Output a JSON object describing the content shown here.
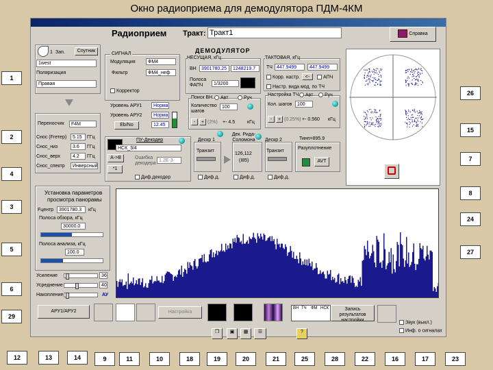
{
  "page_title": "Окно радиоприема для демодулятора ПДМ-4КМ",
  "window": {
    "header_title": "Радиоприем",
    "trakt_label": "Тракт:",
    "trakt_value": "Тракт1",
    "help_button": "Справка"
  },
  "antenna": {
    "zap_label": "Зап.",
    "zap_value": "1",
    "sputnik_button": "Спутник",
    "satellite_value": "1west",
    "polarization_label": "Поляризация",
    "polarization_value": "Правая"
  },
  "converter": {
    "perenoschik_label": "Переносчик",
    "perenoschik_value": "F4M",
    "rows": [
      {
        "label": "Снос (Fгетер)",
        "value": "5.15",
        "unit": "ГГц"
      },
      {
        "label": "Снос_низ",
        "value": "3.6",
        "unit": "ГГц"
      },
      {
        "label": "Снос_верх",
        "value": "4.2",
        "unit": "ГГц"
      },
      {
        "label": "Снос_спектр",
        "value": "Инверсный",
        "unit": ""
      }
    ]
  },
  "signal": {
    "group_title": "СИГНАЛ",
    "modulation_label": "Модуляция",
    "modulation_value": "ФМ4",
    "filter_label": "Фильтр",
    "filter_value": "ФМ4_неф",
    "corrector_label": "Корректор",
    "aru1_label": "Уровень АРУ1",
    "aru1_value": "Норма",
    "aru2_label": "Уровень АРУ2",
    "aru2_value": "Норма",
    "ebno_button": "Eb/No",
    "ebno_value": "12.45"
  },
  "demod": {
    "title": "ДЕМОДУЛЯТОР",
    "carrier_label": "НЕСУЩАЯ, кГц",
    "vn_label": "ВН",
    "vn_value1": "3901780.25",
    "vn_value2": "1248219.7",
    "fapch_label": "Полоса ФАПЧ",
    "fapch_value": "1/3200",
    "search_label": "Поиск ВН",
    "avt_label": "Авт",
    "ruch_label": "Руч",
    "steps_label": "Количество шагов",
    "steps_value": "100",
    "step_info": "(2%)",
    "step_value": "+- 4.5",
    "khz": "кГц"
  },
  "clock": {
    "title": "ТАКТОВАЯ, кГц",
    "tch_label": "ТЧ",
    "tch_value1": "447.9499",
    "tch_value2": "447.9499",
    "korr_label": "Корр. настр.",
    "apch_label": "АПЧ",
    "nastr_label": "Настр. вида мод. по ТЧ",
    "setup_label": "Настройка ТЧ",
    "avt_label": "Авт",
    "ruch_label": "Руч",
    "steps_label": "Кол. шагов",
    "steps_value": "100",
    "step_info": "(0.25%)",
    "step_value": "+- 0.560",
    "khz": "кГц"
  },
  "decoder": {
    "pu_label": "ПУ-Декодер",
    "pu_value": "НСК_3/4",
    "ab_button": "A->B",
    "one_button": "*1",
    "error_label": "Ошибка декодера",
    "error_value": "1.2E-3",
    "dif_decoder_label": "Диф.декодер",
    "desk1_label": "Дескр 1",
    "rs_label": "Дек. Рида-Соломона",
    "desk2_label": "Дескр 2",
    "tinp_label": "Тинп=895.9",
    "tranzit1": "Транзит",
    "rs_value1": "126,112",
    "rs_value2": "(I85)",
    "tranzit2": "Транзит",
    "razuplot_label": "Разуплотнение",
    "avt_button": "AVT",
    "dif1": "Диф.д.",
    "dif2": "Диф.д.",
    "dif3": "Диф.д."
  },
  "panorama": {
    "title1": "Установка параметров",
    "title2": "просмотра панорамы",
    "fcenter_label": "Fцентр",
    "fcenter_value": "3901780.3",
    "khz": "кГц",
    "band_label": "Полоса обзора, кГц",
    "band_value": "30000.0",
    "band_fraction": 0.5,
    "analysis_label": "Полоса анализа, кГц",
    "analysis_value": "100.0",
    "analysis_fraction": 0.35,
    "gain_label": "Усиление",
    "gain_value": "36",
    "avg_label": "Усреднение",
    "avg_value": "40",
    "accum_label": "Накопление",
    "au_label": "АУ"
  },
  "toolbar": {
    "aru_button": "АРУ1/АРУ2",
    "nastroika_button": "Настройка",
    "grid_headers": [
      "ВН",
      "ТЧ",
      "ФМ",
      "НСК"
    ],
    "record_button": "Запись результатов настройки",
    "sound_label": "Звук (выкл.)",
    "info_label": "Инф. о сигналах",
    "help_icon_label": "?"
  },
  "callouts": {
    "left": [
      "1",
      "2",
      "4",
      "3",
      "5",
      "6",
      "29"
    ],
    "right": [
      "26",
      "15",
      "7",
      "8",
      "24",
      "27"
    ],
    "bottom": [
      "12",
      "13",
      "14",
      "9",
      "11",
      "10",
      "18",
      "19",
      "20",
      "21",
      "25",
      "28",
      "22",
      "16",
      "17",
      "23"
    ]
  },
  "colors": {
    "window_bg": "#d4d0c8",
    "spectrum": "#1a1a8c",
    "constellation": "#2a2a90",
    "page_bg": "#d9c8a8"
  }
}
